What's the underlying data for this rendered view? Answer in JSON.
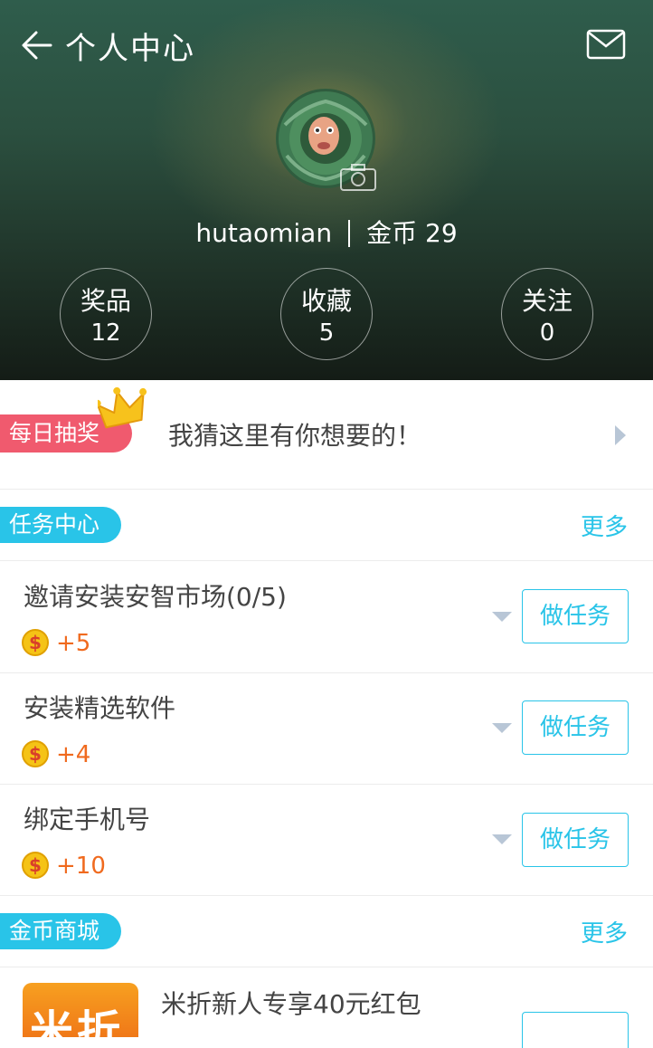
{
  "header": {
    "title": "个人中心",
    "back_icon": "back-arrow-icon",
    "mail_icon": "mail-icon"
  },
  "profile": {
    "username": "hutaomian",
    "coins_label": "金币",
    "coins_value": "29"
  },
  "stats": [
    {
      "label": "奖品",
      "value": "12"
    },
    {
      "label": "收藏",
      "value": "5"
    },
    {
      "label": "关注",
      "value": "0"
    }
  ],
  "lottery": {
    "tag": "每日抽奖",
    "text": "我猜这里有你想要的！"
  },
  "tasks": {
    "title": "任务中心",
    "more": "更多",
    "items": [
      {
        "name": "邀请安装安智市场(0/5)",
        "reward": "+5",
        "button": "做任务"
      },
      {
        "name": "安装精选软件",
        "reward": "+4",
        "button": "做任务"
      },
      {
        "name": "绑定手机号",
        "reward": "+10",
        "button": "做任务"
      }
    ]
  },
  "shop": {
    "title": "金币商城",
    "more": "更多",
    "items": [
      {
        "logo_text": "米折",
        "name": "米折新人专享40元红包"
      }
    ]
  },
  "colors": {
    "accent": "#29c4e8",
    "lottery": "#f05a6e",
    "reward": "#f06a1e",
    "coin": "#f5c316"
  }
}
